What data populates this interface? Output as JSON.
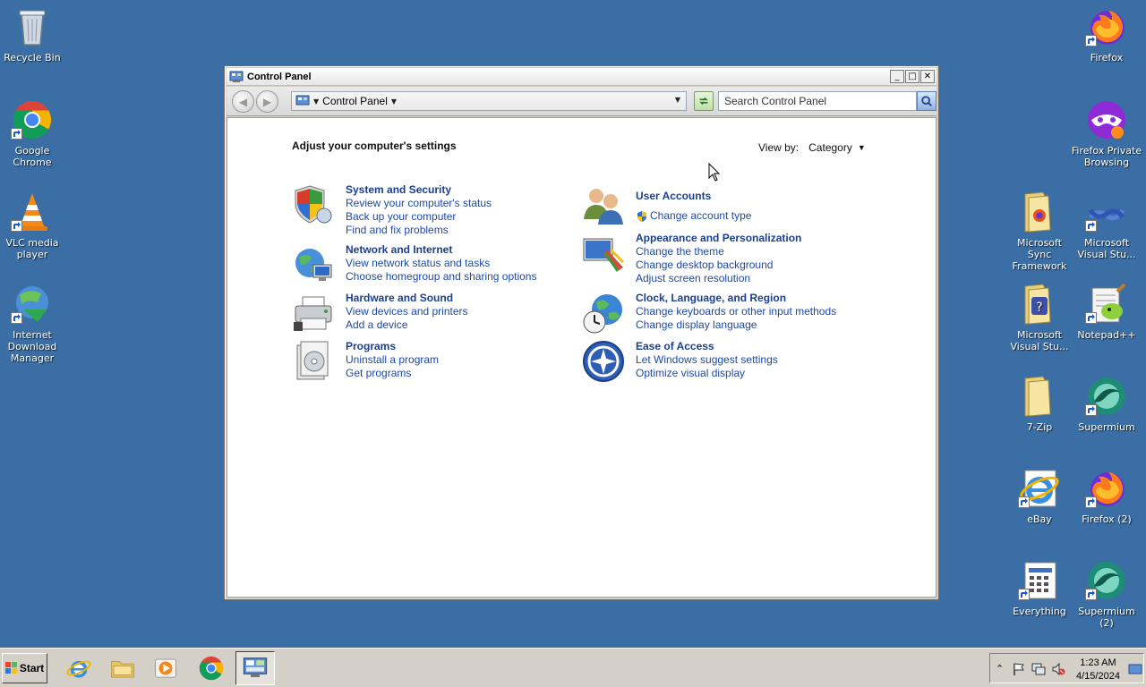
{
  "desktop": {
    "left_icons": [
      {
        "label": "Recycle Bin",
        "icon": "recycle-bin"
      },
      {
        "label": "Google Chrome",
        "icon": "chrome"
      },
      {
        "label": "VLC media player",
        "icon": "vlc"
      },
      {
        "label": "Internet Download Manager",
        "icon": "idm"
      }
    ],
    "right_icons": [
      {
        "label": "Firefox",
        "icon": "firefox"
      },
      {
        "label": "Firefox Private Browsing",
        "icon": "firefox-private"
      },
      {
        "label": "Microsoft Sync Framework",
        "icon": "folder"
      },
      {
        "label": "Microsoft Visual Stu...",
        "icon": "visual-studio"
      },
      {
        "label": "Microsoft Visual Stu...",
        "icon": "folder"
      },
      {
        "label": "Notepad++",
        "icon": "notepad-plus-plus"
      },
      {
        "label": "7-Zip",
        "icon": "folder"
      },
      {
        "label": "Supermium",
        "icon": "supermium"
      },
      {
        "label": "eBay",
        "icon": "internet-explorer"
      },
      {
        "label": "Firefox (2)",
        "icon": "firefox"
      },
      {
        "label": "Everything",
        "icon": "everything"
      },
      {
        "label": "Supermium (2)",
        "icon": "supermium"
      }
    ]
  },
  "window": {
    "title": "Control Panel",
    "buttons": {
      "minimize": "_",
      "maximize": "□",
      "close": "✕"
    },
    "address": {
      "location": "Control Panel"
    },
    "search": {
      "placeholder": "Search Control Panel"
    },
    "heading": "Adjust your computer's settings",
    "view_by": {
      "label": "View by:",
      "value": "Category"
    },
    "categories": {
      "system_security": {
        "title": "System and Security",
        "links": [
          "Review your computer's status",
          "Back up your computer",
          "Find and fix problems"
        ]
      },
      "network_internet": {
        "title": "Network and Internet",
        "links": [
          "View network status and tasks",
          "Choose homegroup and sharing options"
        ]
      },
      "hardware_sound": {
        "title": "Hardware and Sound",
        "links": [
          "View devices and printers",
          "Add a device"
        ]
      },
      "programs": {
        "title": "Programs",
        "links": [
          "Uninstall a program",
          "Get programs"
        ]
      },
      "user_accounts": {
        "title": "User Accounts",
        "links": [
          "Change account type"
        ]
      },
      "appearance": {
        "title": "Appearance and Personalization",
        "links": [
          "Change the theme",
          "Change desktop background",
          "Adjust screen resolution"
        ]
      },
      "clock_region": {
        "title": "Clock, Language, and Region",
        "links": [
          "Change keyboards or other input methods",
          "Change display language"
        ]
      },
      "ease_access": {
        "title": "Ease of Access",
        "links": [
          "Let Windows suggest settings",
          "Optimize visual display"
        ]
      }
    }
  },
  "taskbar": {
    "start_label": "Start",
    "pinned": [
      "internet-explorer",
      "windows-explorer",
      "media-player",
      "chrome",
      "control-panel"
    ],
    "clock": {
      "time": "1:23 AM",
      "date": "4/15/2024"
    }
  },
  "colors": {
    "desktop": "#3a6ea5",
    "link": "#1e4aa8",
    "category_title": "#1a3f91"
  }
}
